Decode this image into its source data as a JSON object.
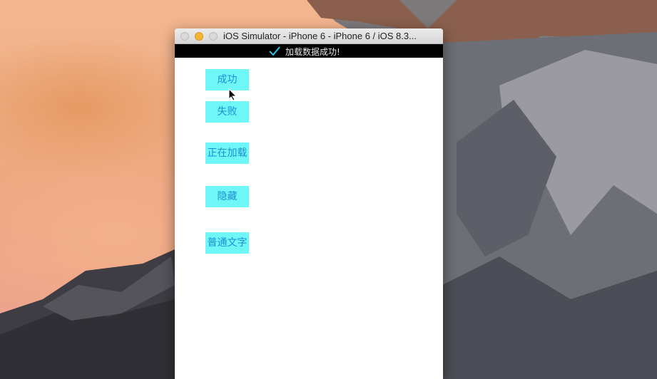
{
  "window": {
    "title": "iOS Simulator - iPhone 6 - iPhone 6 / iOS 8.3..."
  },
  "status": {
    "icon": "checkmark-icon",
    "message": "加载数据成功!"
  },
  "buttons": [
    {
      "label": "成功"
    },
    {
      "label": "失败"
    },
    {
      "label": "正在加载"
    },
    {
      "label": "隐藏"
    },
    {
      "label": "普通文字"
    }
  ],
  "colors": {
    "button_bg": "#6ff7f7",
    "button_text": "#1d8fcf",
    "checkmark": "#2ec4e6",
    "minimize_light": "#f5b632"
  }
}
